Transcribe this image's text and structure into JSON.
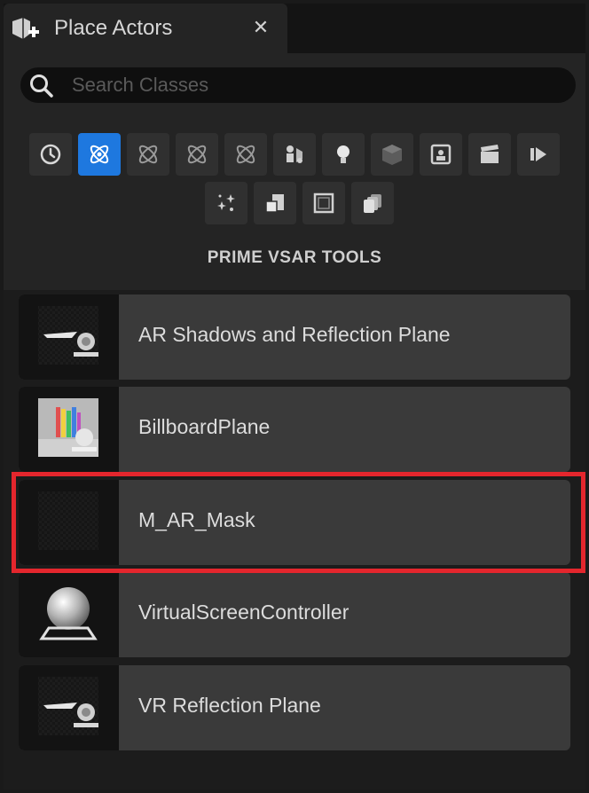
{
  "tab": {
    "title": "Place Actors",
    "close_glyph": "✕",
    "icon": "place-actors-icon"
  },
  "search": {
    "placeholder": "Search Classes",
    "value": "",
    "icon": "search-icon"
  },
  "categories": {
    "row1": [
      {
        "name": "recently-placed-icon",
        "selected": false
      },
      {
        "name": "prime-vsar-tools-icon",
        "selected": true
      },
      {
        "name": "vsar-category-icon",
        "selected": false
      },
      {
        "name": "vsar-category-icon",
        "selected": false
      },
      {
        "name": "vsar-category-icon",
        "selected": false
      },
      {
        "name": "basic-actors-icon",
        "selected": false
      },
      {
        "name": "lights-icon",
        "selected": false
      },
      {
        "name": "shapes-icon",
        "selected": false
      },
      {
        "name": "cinematic-icon",
        "selected": false
      },
      {
        "name": "visual-effects-icon",
        "selected": false
      },
      {
        "name": "media-icon",
        "selected": false
      }
    ],
    "row2": [
      {
        "name": "particles-icon",
        "selected": false
      },
      {
        "name": "geometry-icon",
        "selected": false
      },
      {
        "name": "volumes-icon",
        "selected": false
      },
      {
        "name": "all-classes-icon",
        "selected": false
      }
    ]
  },
  "section_title": "PRIME VSAR TOOLS",
  "items": [
    {
      "label": "AR Shadows and Reflection Plane",
      "thumbnail": "reflection-plane-thumbnail"
    },
    {
      "label": "BillboardPlane",
      "thumbnail": "billboard-plane-thumbnail"
    },
    {
      "label": "M_AR_Mask",
      "thumbnail": "material-thumbnail"
    },
    {
      "label": "VirtualScreenController",
      "thumbnail": "sphere-actor-thumbnail"
    },
    {
      "label": "VR Reflection Plane",
      "thumbnail": "reflection-plane-thumbnail"
    }
  ],
  "colors": {
    "accent": "#1e78df",
    "highlight": "#e4262d",
    "panel": "#242424",
    "item": "#3a3a3a"
  }
}
